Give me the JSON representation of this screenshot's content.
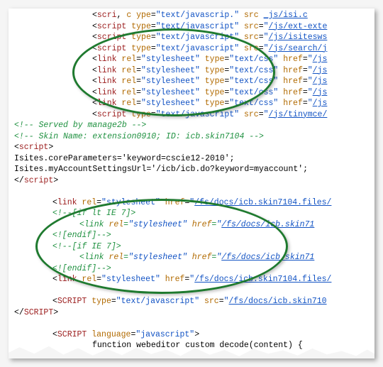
{
  "line1": {
    "tag": "scri",
    "typeLabel": "c ype",
    "typeVal": "text/javascrip.",
    "srcLabel": "src",
    "srcVal": "_js/isi.c"
  },
  "scripts_top": [
    {
      "tag": "script",
      "typeVal": "text/javascript",
      "srcVal": "/js/ext-exte"
    },
    {
      "tag": "script",
      "typeVal": "text/javascript",
      "srcVal": "/js/isitesws"
    },
    {
      "tag": "script",
      "typeVal": "text/javascript",
      "srcVal": "/js/search/j"
    }
  ],
  "links_top": [
    {
      "tag": "link",
      "relVal": "stylesheet",
      "typeVal": "text/css",
      "hrefVal": "/js"
    },
    {
      "tag": "link",
      "relVal": "stylesheet",
      "typeVal": "text/css",
      "hrefVal": "/js"
    },
    {
      "tag": "link",
      "relVal": "stylesheet",
      "typeVal": "text/css",
      "hrefVal": "/js"
    },
    {
      "tag": "link",
      "relVal": "stylesheet",
      "typeVal": "text/css",
      "hrefVal": "/js"
    },
    {
      "tag": "link",
      "relVal": "stylesheet",
      "typeVal": "text/css",
      "hrefVal": "/js"
    }
  ],
  "tinymce": {
    "tag": "script",
    "typeVal": "text/javascript",
    "srcVal": "/js/tinymce/"
  },
  "comment1": "<!-- Served by manage2b -->",
  "comment2": "<!-- Skin Name: extension0910; ID: icb.skin7104 -->",
  "scriptOpen": "<script>",
  "jsLine1": "Isites.coreParameters='keyword=cscie12-2010';",
  "jsLine2": "Isites.myAccountSettingsUrl='/icb/icb.do?keyword=myaccount';",
  "scriptClose": "script",
  "block2": {
    "link1": {
      "relVal": "stylesheet",
      "hrefVal": "/fs/docs/icb.skin7104.files/"
    },
    "ifLt": "<!--[if lt IE 7]>",
    "innerLink1": {
      "relVal": "stylesheet",
      "hrefVal": "/fs/docs/icb.skin71"
    },
    "endif1": "<![endif]-->",
    "if7": "<!--[if IE 7]>",
    "innerLink2": {
      "relVal": "stylesheet",
      "hrefVal": "/fs/docs/icb.skin71"
    },
    "endif2": "<![endif]-->",
    "link2": {
      "relVal": "stylesheet",
      "hrefVal": "/fs/docs/icb.skin7104.files/"
    }
  },
  "scriptUpper": {
    "tag": "SCRIPT",
    "typeVal": "text/javascript",
    "srcVal": "/fs/docs/icb.skin710"
  },
  "scriptCloseUpper": "SCRIPT",
  "scriptLang": {
    "tag": "SCRIPT",
    "langVal": "javascript"
  },
  "funcLine": "function webeditor custom decode(content) {"
}
